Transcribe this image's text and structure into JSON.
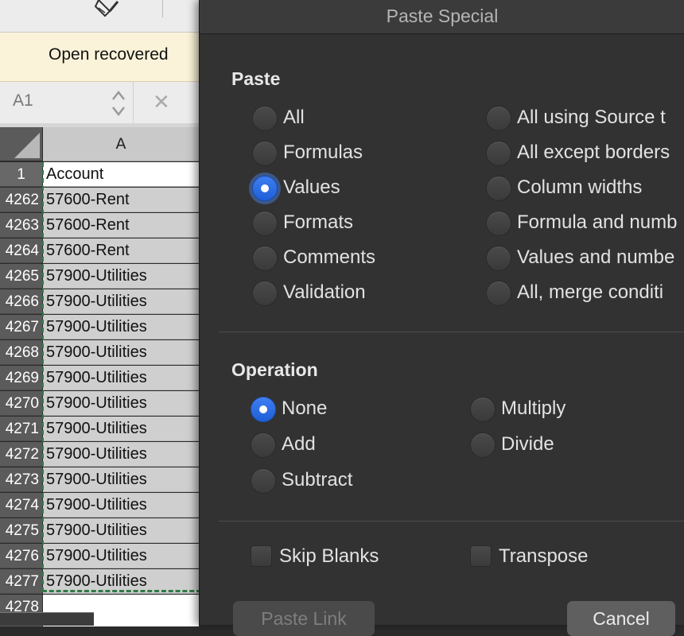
{
  "spreadsheet": {
    "infobar_text": "Open recovered",
    "name_box": "A1",
    "column_header": "A",
    "rows": [
      {
        "num": "1",
        "value": "Account"
      },
      {
        "num": "4262",
        "value": "57600-Rent"
      },
      {
        "num": "4263",
        "value": "57600-Rent"
      },
      {
        "num": "4264",
        "value": "57600-Rent"
      },
      {
        "num": "4265",
        "value": "57900-Utilities"
      },
      {
        "num": "4266",
        "value": "57900-Utilities"
      },
      {
        "num": "4267",
        "value": "57900-Utilities"
      },
      {
        "num": "4268",
        "value": "57900-Utilities"
      },
      {
        "num": "4269",
        "value": "57900-Utilities"
      },
      {
        "num": "4270",
        "value": "57900-Utilities"
      },
      {
        "num": "4271",
        "value": "57900-Utilities"
      },
      {
        "num": "4272",
        "value": "57900-Utilities"
      },
      {
        "num": "4273",
        "value": "57900-Utilities"
      },
      {
        "num": "4274",
        "value": "57900-Utilities"
      },
      {
        "num": "4275",
        "value": "57900-Utilities"
      },
      {
        "num": "4276",
        "value": "57900-Utilities"
      },
      {
        "num": "4277",
        "value": "57900-Utilities"
      }
    ],
    "last_row_num": "4278"
  },
  "dialog": {
    "title": "Paste Special",
    "paste": {
      "heading": "Paste",
      "left": [
        "All",
        "Formulas",
        "Values",
        "Formats",
        "Comments",
        "Validation"
      ],
      "right": [
        "All using Source t",
        "All except borders",
        "Column widths",
        "Formula and numb",
        "Values and numbe",
        "All, merge conditi"
      ],
      "selected": "Values"
    },
    "operation": {
      "heading": "Operation",
      "left": [
        "None",
        "Add",
        "Subtract"
      ],
      "right": [
        "Multiply",
        "Divide"
      ],
      "selected": "None"
    },
    "options": {
      "skip_blanks": "Skip Blanks",
      "transpose": "Transpose"
    },
    "buttons": {
      "paste_link": "Paste Link",
      "cancel": "Cancel"
    }
  },
  "colors": {
    "accent": "#2a6de6",
    "dialog_bg": "#323232",
    "marquee": "#2f7a46",
    "infobar_bg": "#fbf3d9"
  }
}
